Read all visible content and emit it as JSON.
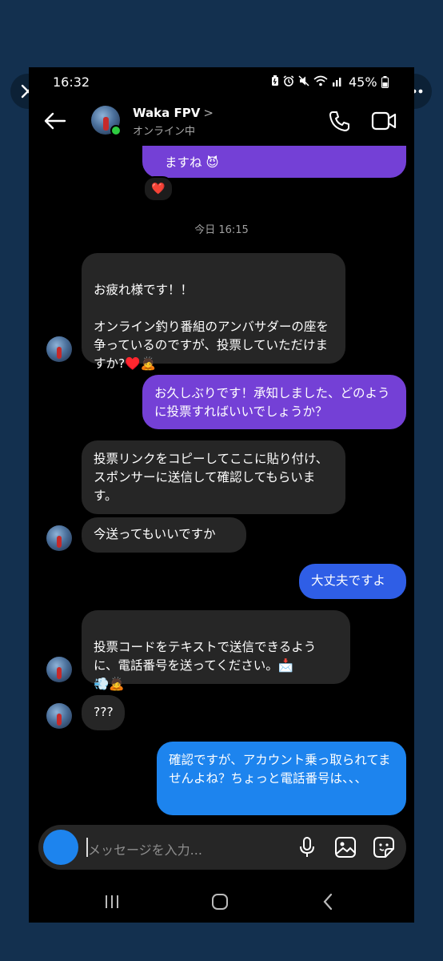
{
  "viewer": {
    "close_icon": "close-icon",
    "more_icon": "more-horizontal-icon"
  },
  "status_bar": {
    "time": "16:32",
    "battery": "45%",
    "icons": [
      "battery-saver-icon",
      "alarm-icon",
      "mute-icon",
      "wifi-icon",
      "signal-icon"
    ]
  },
  "header": {
    "name": "Waka FPV",
    "chevron": ">",
    "status": "オンライン中",
    "icons": [
      "back-arrow-icon",
      "phone-icon",
      "video-call-icon"
    ]
  },
  "messages": [
    {
      "from": "me",
      "text": "ますね 😈",
      "partial": true
    },
    {
      "reaction": "❤️"
    },
    {
      "timestamp": "今日 16:15"
    },
    {
      "from": "them",
      "text": "お疲れ様です！！\n\nオンライン釣り番組のアンバサダーの座を争っているのですが、投票していただけますか?♥️🙇"
    },
    {
      "from": "me",
      "text": "お久しぶりです！承知しました、どのように投票すればいいでしょうか？"
    },
    {
      "from": "them",
      "text": "投票リンクをコピーしてここに貼り付け、スポンサーに送信して確認してもらいます。"
    },
    {
      "from": "them",
      "text": "今送ってもいいですか"
    },
    {
      "from": "me",
      "text": "大丈夫ですよ"
    },
    {
      "from": "them",
      "text": "投票コードをテキストで送信できるように、電話番号を送ってください。📩\n💨🙇"
    },
    {
      "from": "them",
      "text": "???"
    },
    {
      "from": "me",
      "text": "確認ですが、アカウント乗っ取られてませんよね？ちょっと電話番号は、、、"
    }
  ],
  "composer": {
    "placeholder": "メッセージを入力...",
    "icons": [
      "camera-icon",
      "microphone-icon",
      "gallery-icon",
      "sticker-icon"
    ]
  },
  "nav_bar": {
    "icons": [
      "recent-apps-icon",
      "home-icon",
      "back-icon"
    ]
  },
  "colors": {
    "incoming": "#262626",
    "outgoing_purple": "#7440d6",
    "outgoing_blue": "#2f5ee6",
    "outgoing_light_blue": "#1d84ee",
    "online": "#2ecc40"
  }
}
